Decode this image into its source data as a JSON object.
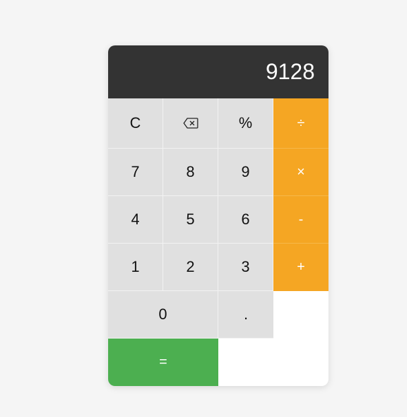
{
  "display": {
    "value": "9128"
  },
  "keys": {
    "clear": "C",
    "percent": "%",
    "divide": "÷",
    "seven": "7",
    "eight": "8",
    "nine": "9",
    "multiply": "×",
    "four": "4",
    "five": "5",
    "six": "6",
    "subtract": "-",
    "one": "1",
    "two": "2",
    "three": "3",
    "add": "+",
    "zero": "0",
    "decimal": ".",
    "equals": "="
  },
  "icons": {
    "backspace": "backspace-icon"
  },
  "colors": {
    "display_bg": "#333333",
    "key_bg": "#e0e0e0",
    "operator_bg": "#f5a623",
    "equals_bg": "#4caf50"
  }
}
